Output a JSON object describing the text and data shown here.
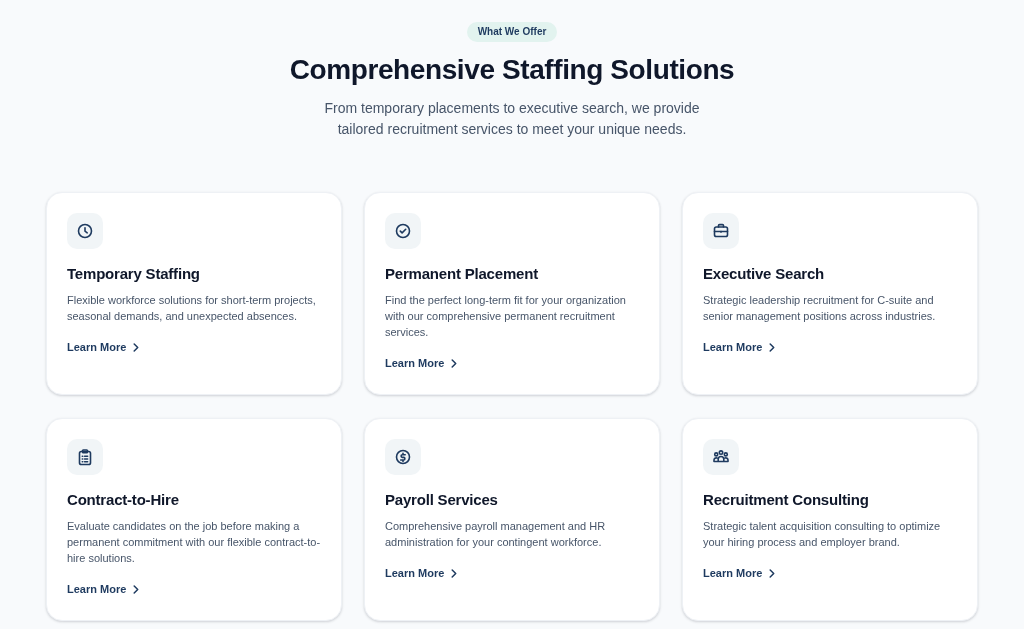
{
  "section": {
    "eyebrow": "What We Offer",
    "title": "Comprehensive Staffing Solutions",
    "subtitle": "From temporary placements to executive search, we provide tailored recruitment services to meet your unique needs."
  },
  "services": [
    {
      "kind": "clock",
      "title": "Temporary Staffing",
      "description": "Flexible workforce solutions for short-term projects, seasonal demands, and unexpected absences.",
      "link": "Learn More"
    },
    {
      "kind": "check",
      "title": "Permanent Placement",
      "description": "Find the perfect long-term fit for your organization with our comprehensive permanent recruitment services.",
      "link": "Learn More"
    },
    {
      "kind": "briefcase",
      "title": "Executive Search",
      "description": "Strategic leadership recruitment for C-suite and senior management positions across industries.",
      "link": "Learn More"
    },
    {
      "kind": "clipboard",
      "title": "Contract-to-Hire",
      "description": "Evaluate candidates on the job before making a permanent commitment with our flexible contract-to-hire solutions.",
      "link": "Learn More"
    },
    {
      "kind": "dollar",
      "title": "Payroll Services",
      "description": "Comprehensive payroll management and HR administration for your contingent workforce.",
      "link": "Learn More"
    },
    {
      "kind": "people",
      "title": "Recruitment Consulting",
      "description": "Strategic talent acquisition consulting to optimize your hiring process and employer brand.",
      "link": "Learn More"
    }
  ]
}
